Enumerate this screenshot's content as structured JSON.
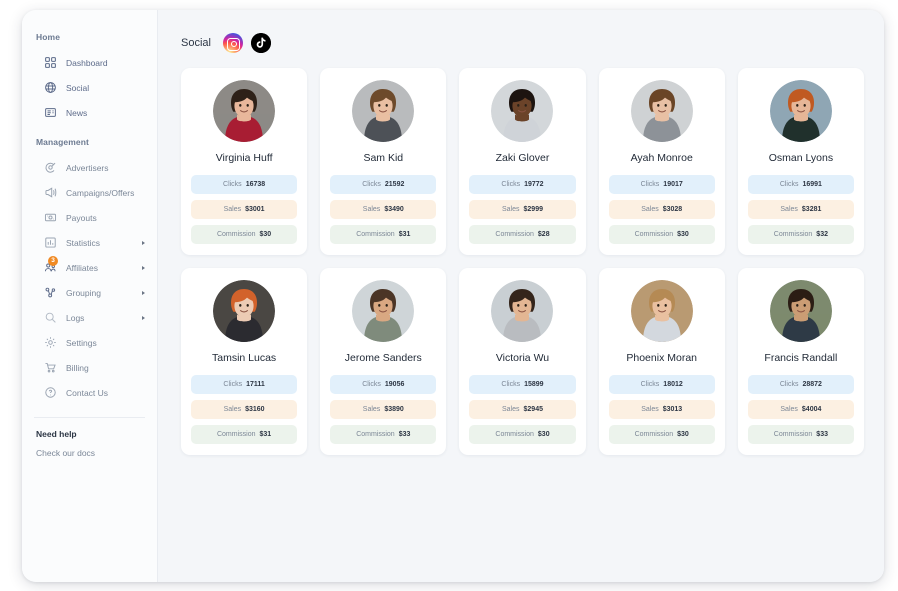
{
  "sidebar": {
    "sections": [
      {
        "title": "Home",
        "items": [
          {
            "label": "Dashboard",
            "icon": "dashboard-icon",
            "caret": false,
            "badge": null
          },
          {
            "label": "Social",
            "icon": "globe-icon",
            "caret": false,
            "badge": null
          },
          {
            "label": "News",
            "icon": "news-icon",
            "caret": false,
            "badge": null
          }
        ]
      },
      {
        "title": "Management",
        "items": [
          {
            "label": "Advertisers",
            "icon": "advertisers-icon",
            "caret": false,
            "badge": null
          },
          {
            "label": "Campaigns/Offers",
            "icon": "megaphone-icon",
            "caret": false,
            "badge": null
          },
          {
            "label": "Payouts",
            "icon": "money-icon",
            "caret": false,
            "badge": null
          },
          {
            "label": "Statistics",
            "icon": "bar-chart-icon",
            "caret": true,
            "badge": null
          },
          {
            "label": "Affiliates",
            "icon": "affiliates-icon",
            "caret": true,
            "badge": "3"
          },
          {
            "label": "Grouping",
            "icon": "grouping-icon",
            "caret": true,
            "badge": null
          },
          {
            "label": "Logs",
            "icon": "search-icon",
            "caret": true,
            "badge": null
          },
          {
            "label": "Settings",
            "icon": "gear-icon",
            "caret": false,
            "badge": null
          },
          {
            "label": "Billing",
            "icon": "cart-icon",
            "caret": false,
            "badge": null
          },
          {
            "label": "Contact Us",
            "icon": "help-circle-icon",
            "caret": false,
            "badge": null
          }
        ]
      }
    ],
    "help": {
      "title": "Need help",
      "link": "Check our docs"
    },
    "badge_color": "#f08a24"
  },
  "header": {
    "title": "Social",
    "social_icons": [
      {
        "name": "instagram-icon"
      },
      {
        "name": "tiktok-icon"
      }
    ]
  },
  "stat_labels": {
    "clicks": "Clicks",
    "sales": "Sales",
    "commission": "Commission"
  },
  "colors": {
    "clicks_bg": "#e2f0fb",
    "sales_bg": "#fcf0e2",
    "commission_bg": "#ecf3ec",
    "badge": "#f08a24"
  },
  "cards": [
    {
      "name": "Virginia Huff",
      "clicks": "16738",
      "sales": "$3001",
      "commission": "$30",
      "avatar": {
        "skin": "#e8b79b",
        "hair": "#2e2118",
        "clothes": "#a81d33",
        "bg": "#8d8a86"
      }
    },
    {
      "name": "Sam Kid",
      "clicks": "21592",
      "sales": "$3490",
      "commission": "$31",
      "avatar": {
        "skin": "#e9bfa2",
        "hair": "#6d4a2b",
        "clothes": "#4d5157",
        "bg": "#b9bbbd"
      }
    },
    {
      "name": "Zaki Glover",
      "clicks": "19772",
      "sales": "$2999",
      "commission": "$28",
      "avatar": {
        "skin": "#6b4329",
        "hair": "#1d1410",
        "clothes": "#cfd3d8",
        "bg": "#d3d7da"
      }
    },
    {
      "name": "Ayah Monroe",
      "clicks": "19017",
      "sales": "$3028",
      "commission": "$30",
      "avatar": {
        "skin": "#e8c0a4",
        "hair": "#6a4526",
        "clothes": "#8d9298",
        "bg": "#cfd2d4"
      }
    },
    {
      "name": "Osman Lyons",
      "clicks": "16991",
      "sales": "$3281",
      "commission": "$32",
      "avatar": {
        "skin": "#e6b697",
        "hair": "#c05a22",
        "clothes": "#20302c",
        "bg": "#8fa6b4"
      }
    },
    {
      "name": "Tamsin Lucas",
      "clicks": "17111",
      "sales": "$3160",
      "commission": "$31",
      "avatar": {
        "skin": "#eccbb4",
        "hair": "#d2622b",
        "clothes": "#2b2b30",
        "bg": "#4a4743"
      }
    },
    {
      "name": "Jerome Sanders",
      "clicks": "19056",
      "sales": "$3890",
      "commission": "$33",
      "avatar": {
        "skin": "#d9a882",
        "hair": "#4b3526",
        "clothes": "#7f8b7c",
        "bg": "#cfd5d8"
      }
    },
    {
      "name": "Victoria Wu",
      "clicks": "15899",
      "sales": "$2945",
      "commission": "$30",
      "avatar": {
        "skin": "#e3b693",
        "hair": "#34251b",
        "clothes": "#b9bcc0",
        "bg": "#c9cfd3"
      }
    },
    {
      "name": "Phoenix Moran",
      "clicks": "18012",
      "sales": "$3013",
      "commission": "$30",
      "avatar": {
        "skin": "#e9c0a0",
        "hair": "#b58a54",
        "clothes": "#d3d8de",
        "bg": "#b99a72"
      }
    },
    {
      "name": "Francis Randall",
      "clicks": "28872",
      "sales": "$4004",
      "commission": "$33",
      "avatar": {
        "skin": "#cb9d74",
        "hair": "#2b1d14",
        "clothes": "#2e3a46",
        "bg": "#7d8a6e"
      }
    }
  ]
}
